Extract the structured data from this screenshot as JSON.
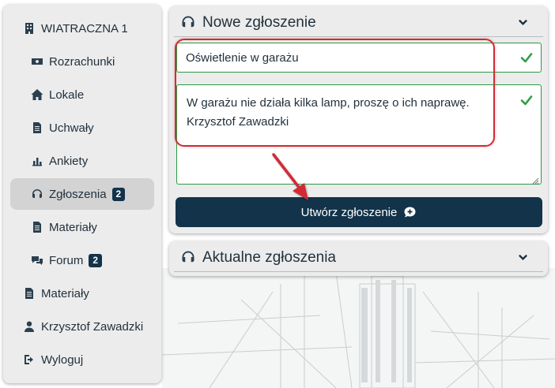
{
  "sidebar": {
    "items": [
      {
        "label": "WIATRACZNA 1",
        "icon": "building-icon"
      },
      {
        "label": "Rozrachunki",
        "icon": "money-icon"
      },
      {
        "label": "Lokale",
        "icon": "home-icon"
      },
      {
        "label": "Uchwały",
        "icon": "document-icon"
      },
      {
        "label": "Ankiety",
        "icon": "bar-chart-icon"
      },
      {
        "label": "Zgłoszenia",
        "icon": "headset-icon",
        "badge": "2",
        "active": true
      },
      {
        "label": "Materiały",
        "icon": "document-icon"
      },
      {
        "label": "Forum",
        "icon": "chat-icon",
        "badge": "2"
      },
      {
        "label": "Materiały",
        "icon": "document-icon"
      },
      {
        "label": "Krzysztof Zawadzki",
        "icon": "user-icon"
      },
      {
        "label": "Wyloguj",
        "icon": "logout-icon"
      }
    ]
  },
  "new_ticket": {
    "title": "Nowe zgłoszenie",
    "subject_value": "Oświetlenie w garażu",
    "body_line1": "W garażu nie działa kilka lamp, proszę o ich naprawę.",
    "body_line2": "Krzysztof Zawadzki",
    "submit_label": "Utwórz zgłoszenie"
  },
  "current_tickets": {
    "title": "Aktualne zgłoszenia"
  },
  "colors": {
    "primary": "#12334a",
    "valid": "#2e9e44",
    "annotation": "#d22b35"
  }
}
